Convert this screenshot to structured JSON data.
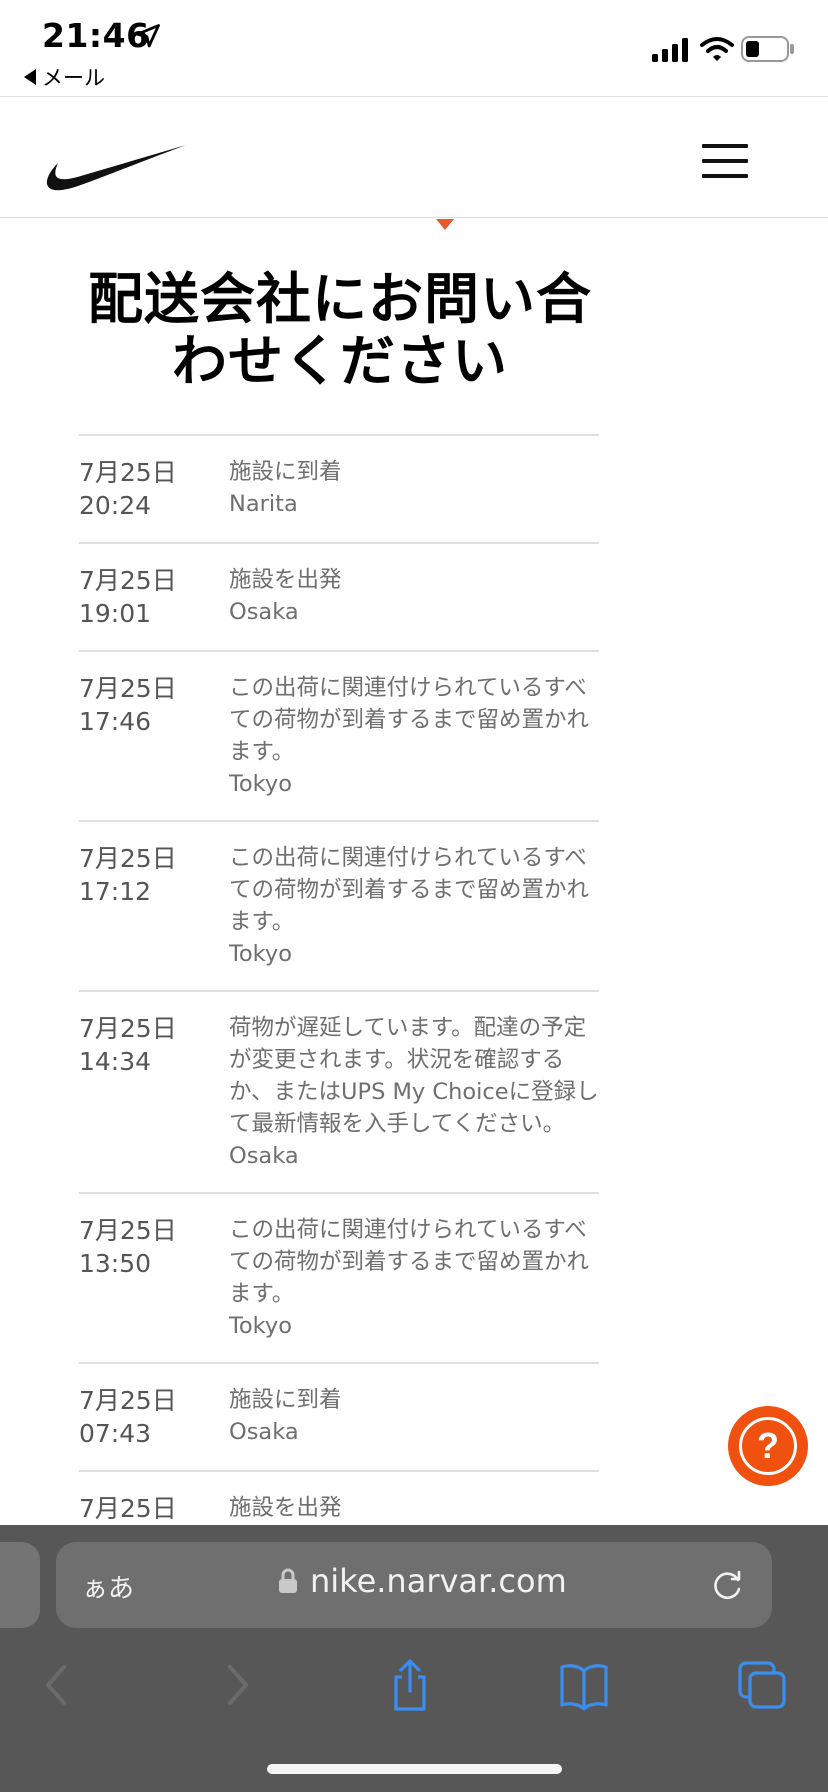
{
  "status_bar": {
    "time": "21:46",
    "back_app": "メール"
  },
  "header": {
    "logo": "nike-swoosh"
  },
  "page": {
    "title": "配送会社にお問い合わせください"
  },
  "events": [
    {
      "date": "7月25日",
      "time": "20:24",
      "description": "施設に到着",
      "location": "Narita"
    },
    {
      "date": "7月25日",
      "time": "19:01",
      "description": "施設を出発",
      "location": "Osaka"
    },
    {
      "date": "7月25日",
      "time": "17:46",
      "description": "この出荷に関連付けられているすべての荷物が到着するまで留め置かれます。",
      "location": "Tokyo"
    },
    {
      "date": "7月25日",
      "time": "17:12",
      "description": "この出荷に関連付けられているすべての荷物が到着するまで留め置かれます。",
      "location": "Tokyo"
    },
    {
      "date": "7月25日",
      "time": "14:34",
      "description": "荷物が遅延しています。配達の予定が変更されます。状況を確認するか、またはUPS My Choiceに登録して最新情報を入手してください。",
      "location": "Osaka"
    },
    {
      "date": "7月25日",
      "time": "13:50",
      "description": "この出荷に関連付けられているすべての荷物が到着するまで留め置かれます。",
      "location": "Tokyo"
    },
    {
      "date": "7月25日",
      "time": "07:43",
      "description": "施設に到着",
      "location": "Osaka"
    },
    {
      "date": "7月25日",
      "time": "",
      "description": "施設を出発",
      "location": ""
    }
  ],
  "help_button": {
    "label": "?"
  },
  "safari": {
    "text_size_label": "ぁあ",
    "url": "nike.narvar.com"
  },
  "colors": {
    "accent": "#f0510f",
    "pointer": "#e8592b",
    "toolbar_icon": "#3b8df0",
    "safari_bg": "#575757"
  }
}
